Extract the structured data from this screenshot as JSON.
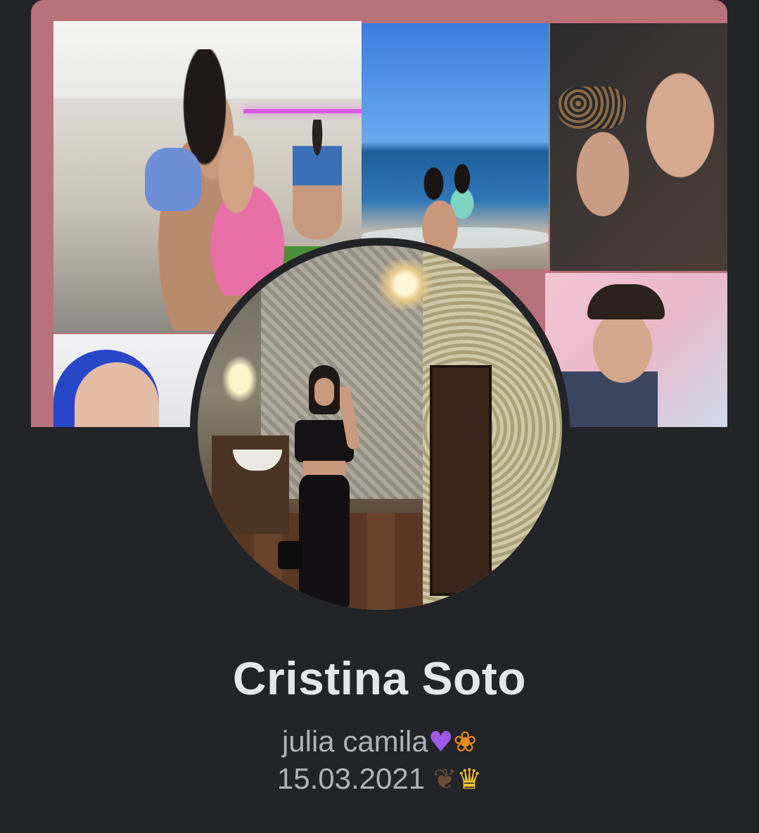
{
  "profile": {
    "name": "Cristina Soto",
    "bio": {
      "line1_text": "julia camila",
      "line1_emojis": [
        {
          "name": "purple-heart-icon",
          "glyph": "♥"
        },
        {
          "name": "butterfly-icon",
          "glyph": "❀"
        }
      ],
      "line2_text": "15.03.2021 ",
      "line2_emojis": [
        {
          "name": "footprints-icon",
          "glyph": "❦"
        },
        {
          "name": "crown-icon",
          "glyph": "♛"
        }
      ]
    }
  },
  "colors": {
    "background": "#232427",
    "cover_border": "#b7727a",
    "name_text": "#e4e6eb",
    "bio_text": "#b0b3b8"
  }
}
